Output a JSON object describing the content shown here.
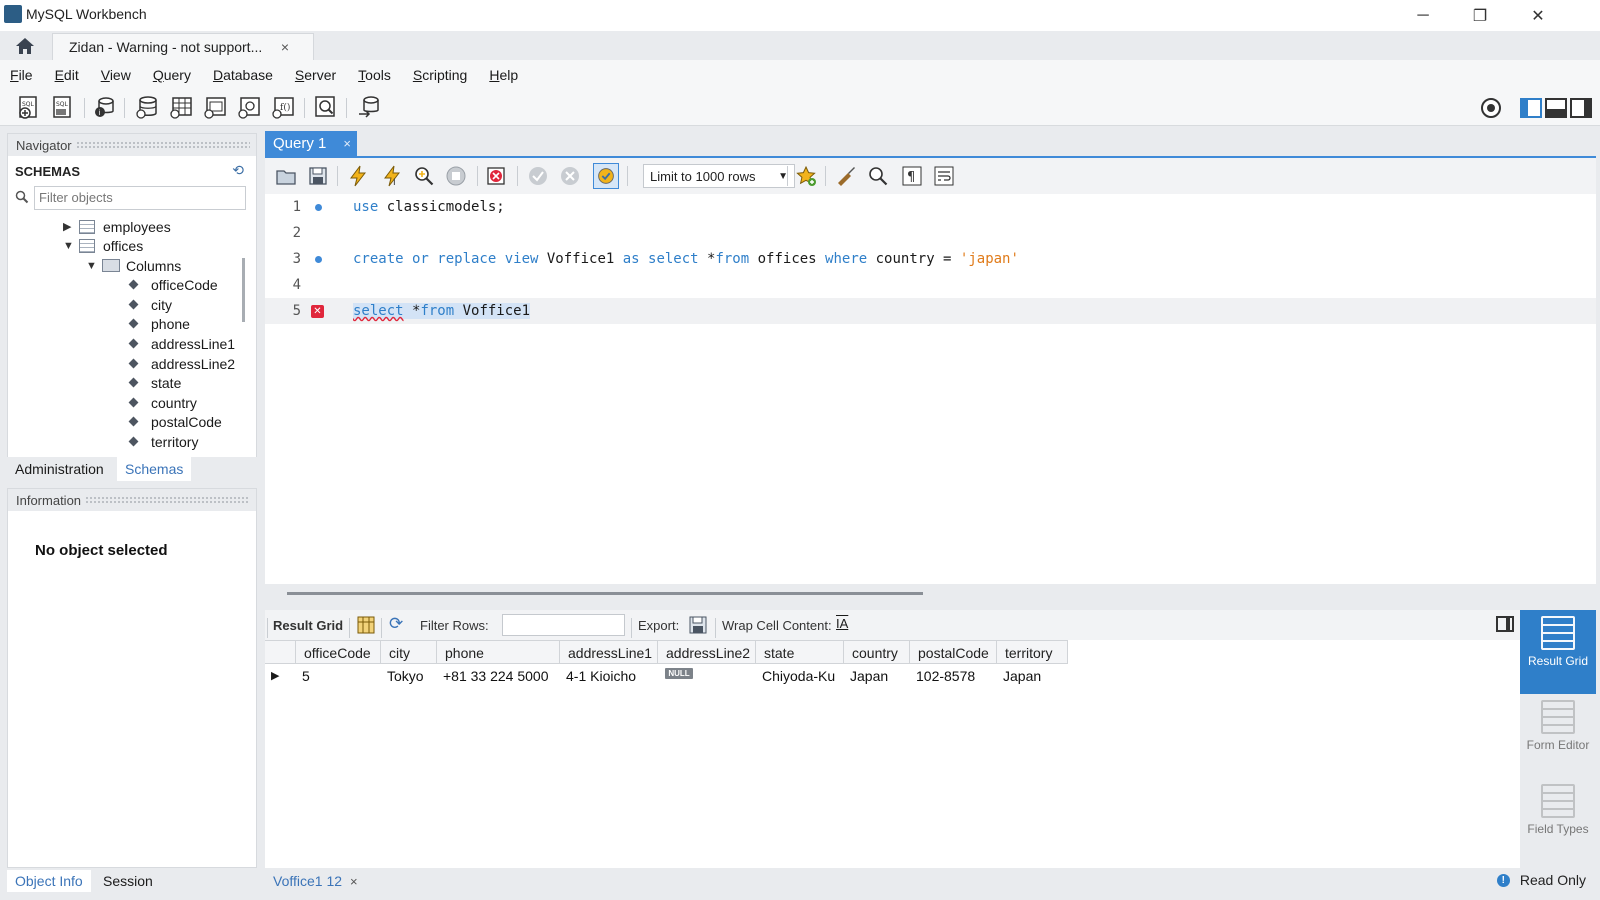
{
  "window": {
    "title": "MySQL Workbench",
    "minimize": "─",
    "restore": "❐",
    "close": "✕"
  },
  "connection_tab": {
    "label": "Zidan - Warning - not support...",
    "close": "×"
  },
  "menu": [
    "File",
    "Edit",
    "View",
    "Query",
    "Database",
    "Server",
    "Tools",
    "Scripting",
    "Help"
  ],
  "navigator": {
    "header": "Navigator",
    "schemas_title": "SCHEMAS",
    "filter_placeholder": "Filter objects",
    "tree": {
      "tables": [
        "employees",
        "offices"
      ],
      "columns_label": "Columns",
      "columns": [
        "officeCode",
        "city",
        "phone",
        "addressLine1",
        "addressLine2",
        "state",
        "country",
        "postalCode",
        "territory"
      ]
    },
    "tabs": [
      "Administration",
      "Schemas"
    ],
    "active_tab": "Schemas"
  },
  "information": {
    "header": "Information",
    "message": "No object selected",
    "tabs": [
      "Object Info",
      "Session"
    ],
    "active_tab": "Object Info"
  },
  "editor": {
    "tab_label": "Query 1",
    "tab_close": "×",
    "limit_select": "Limit to 1000 rows",
    "lines": [
      {
        "number": "1",
        "marker": "dot"
      },
      {
        "number": "2",
        "marker": ""
      },
      {
        "number": "3",
        "marker": "dot"
      },
      {
        "number": "4",
        "marker": ""
      },
      {
        "number": "5",
        "marker": "error"
      }
    ],
    "code": {
      "l1_kw": "use",
      "l1_rest": " classicmodels;",
      "l3_kw1": "create or replace view",
      "l3_name": " Voffice1 ",
      "l3_kw2": "as select",
      "l3_mid": " *",
      "l3_kw3": "from",
      "l3_tbl": " offices ",
      "l3_kw4": "where",
      "l3_col": " country = ",
      "l3_str": "'japan'",
      "l5_kw1": "select",
      "l5_mid": " *",
      "l5_kw2": "from",
      "l5_rest": " Voffice1"
    }
  },
  "result": {
    "tab_label": "Result Grid",
    "filter_label": "Filter Rows:",
    "export_label": "Export:",
    "wrap_label": "Wrap Cell Content:",
    "columns": [
      "officeCode",
      "city",
      "phone",
      "addressLine1",
      "addressLine2",
      "state",
      "country",
      "postalCode",
      "territory"
    ],
    "rows": [
      [
        "5",
        "Tokyo",
        "+81 33 224 5000",
        "4-1 Kioicho",
        "NULL",
        "Chiyoda-Ku",
        "Japan",
        "102-8578",
        "Japan"
      ]
    ]
  },
  "side_panel": {
    "buttons": [
      {
        "label": "Result Grid",
        "state": "active"
      },
      {
        "label": "Form Editor",
        "state": "disabled"
      },
      {
        "label": "Field Types",
        "state": "disabled"
      }
    ]
  },
  "bottom": {
    "result_tab": "Voffice1 12",
    "close": "×",
    "status": "Read Only",
    "status_icon": "!"
  },
  "colors": {
    "accent": "#3f8ad8",
    "keyword": "#2f7fc9",
    "string": "#e07b1a",
    "error": "#e0263b"
  }
}
